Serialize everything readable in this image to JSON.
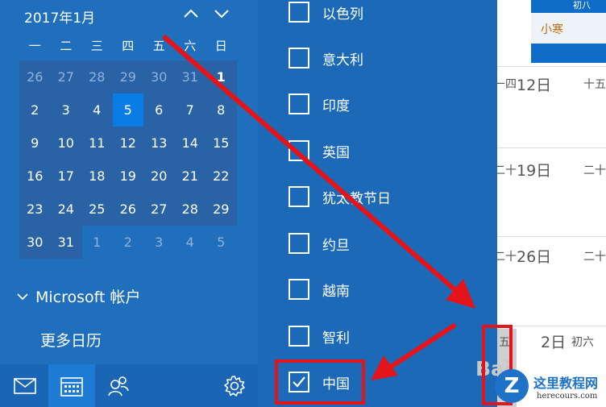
{
  "calendar": {
    "month_title": "2017年1月",
    "weekdays": [
      "一",
      "二",
      "三",
      "四",
      "五",
      "六",
      "日"
    ],
    "days": [
      "26",
      "27",
      "28",
      "29",
      "30",
      "31",
      "1",
      "2",
      "3",
      "4",
      "5",
      "6",
      "7",
      "8",
      "9",
      "10",
      "11",
      "12",
      "13",
      "14",
      "15",
      "16",
      "17",
      "18",
      "19",
      "20",
      "21",
      "22",
      "23",
      "24",
      "25",
      "26",
      "27",
      "28",
      "29",
      "30",
      "31",
      "1",
      "2",
      "3",
      "4",
      "5"
    ],
    "today": "5"
  },
  "sidebar": {
    "account_label": "Microsoft 帐户",
    "more_calendars": "更多日历"
  },
  "holiday_list": {
    "items": [
      {
        "label": "以色列",
        "checked": false
      },
      {
        "label": "意大利",
        "checked": false
      },
      {
        "label": "印度",
        "checked": false
      },
      {
        "label": "英国",
        "checked": false
      },
      {
        "label": "犹太教节日",
        "checked": false
      },
      {
        "label": "约旦",
        "checked": false
      },
      {
        "label": "越南",
        "checked": false
      },
      {
        "label": "智利",
        "checked": false
      },
      {
        "label": "中国",
        "checked": true
      }
    ]
  },
  "right_calendar": {
    "header_fragment": "初八",
    "event": "小寒",
    "rows": [
      {
        "left": "一四",
        "date": "12日",
        "right": "十五"
      },
      {
        "left": "二十",
        "date": "19日",
        "right": "二十"
      },
      {
        "left": "二十",
        "date": "26日",
        "right": "二十"
      },
      {
        "left": "五",
        "date": "2日",
        "right": "初六"
      }
    ],
    "watermark_left": "Bai"
  },
  "watermark": {
    "logo_letter": "Z",
    "site_name": "这里教程网",
    "site_url": "herecours.com"
  },
  "colors": {
    "accent": "#1f6fbd",
    "today": "#0a7de4",
    "annotation": "#e3141a"
  }
}
